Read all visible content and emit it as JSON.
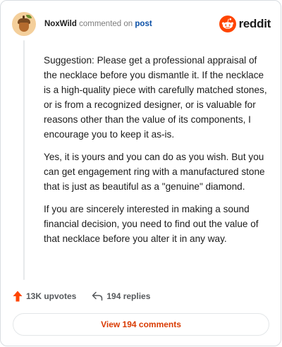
{
  "comment": {
    "username": "NoxWild",
    "action_text": "commented on",
    "target_text": "post",
    "paragraphs": [
      "Suggestion: Please get a professional appraisal of the necklace before you dismantle it. If the necklace is a high-quality piece with carefully matched stones, or is from a recognized designer, or is valuable for reasons other than the value of its components, I encourage you to keep it as-is.",
      "Yes, it is yours and you can do as you wish. But you can get engagement ring with a manufactured stone that is just as beautiful as a \"genuine\" diamond.",
      "If you are sincerely interested in making a sound financial decision, you need to find out the value of that necklace before you alter it in any way."
    ]
  },
  "brand": {
    "name": "reddit",
    "color": "#ff4500"
  },
  "actions": {
    "upvotes": "13K upvotes",
    "replies": "194 replies"
  },
  "footer": {
    "view_comments": "View 194 comments"
  },
  "icons": {
    "avatar": "acorn-avatar",
    "logo": "reddit-snoo-icon",
    "upvote": "upvote-arrow-icon",
    "reply": "reply-arrow-icon"
  }
}
